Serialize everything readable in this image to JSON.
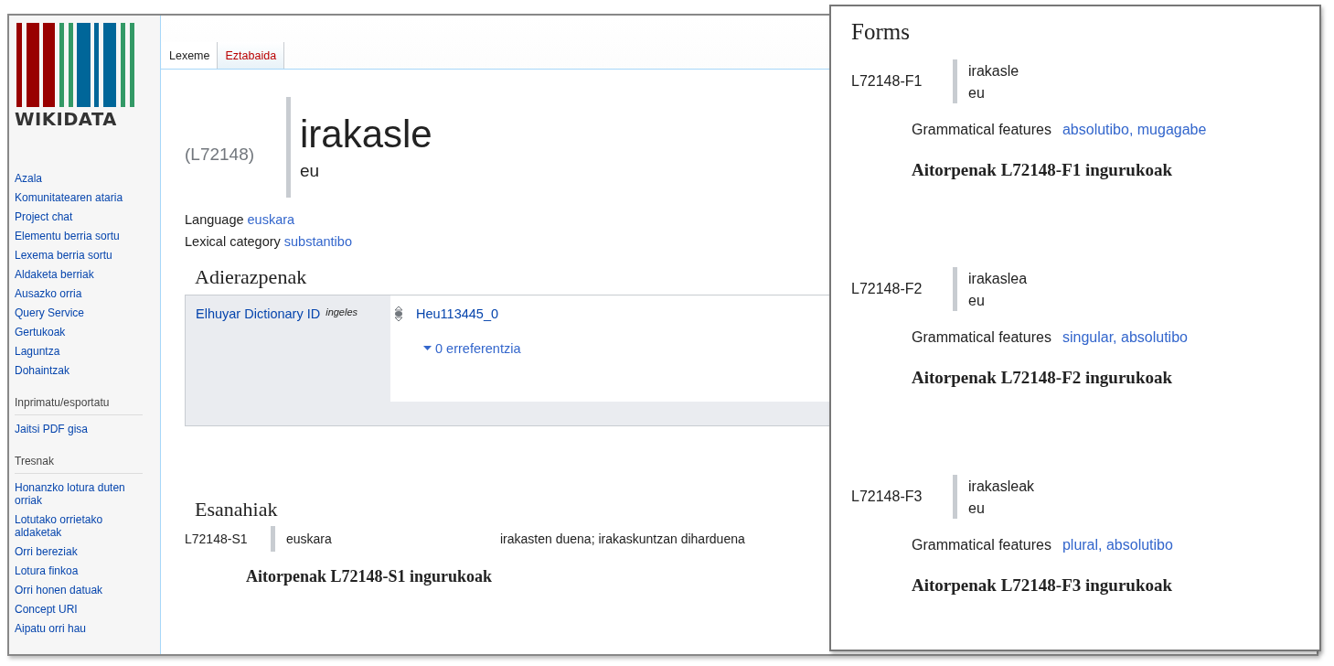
{
  "logo": {
    "wordmark": "WIKIDATA"
  },
  "sidebar": {
    "groups": [
      {
        "items": [
          "Azala",
          "Komunitatearen ataria",
          "Project chat",
          "Elementu berria sortu",
          "Lexema berria sortu",
          "Aldaketa berriak",
          "Ausazko orria",
          "Query Service",
          "Gertukoak",
          "Laguntza",
          "Dohaintzak"
        ]
      },
      {
        "heading": "Inprimatu/esportatu",
        "items": [
          "Jaitsi PDF gisa"
        ]
      },
      {
        "heading": "Tresnak",
        "items": [
          "Honanzko lotura duten orriak",
          "Lotutako orrietako aldaketak",
          "Orri bereziak",
          "Lotura finkoa",
          "Orri honen datuak",
          "Concept URI",
          "Aipatu orri hau"
        ]
      }
    ]
  },
  "tabs": [
    {
      "label": "Lexeme",
      "selected": true
    },
    {
      "label": "Eztabaida",
      "selected": false
    }
  ],
  "lexeme": {
    "id": "(L72148)",
    "lemma": "irakasle",
    "language_code": "eu"
  },
  "properties": [
    {
      "label": "Language",
      "value": "euskara"
    },
    {
      "label": "Lexical category",
      "value": "substantibo"
    }
  ],
  "statements": {
    "heading": "Adierazpenak",
    "items": [
      {
        "property": "Elhuyar Dictionary ID",
        "qualifier": "ingeles",
        "value": "Heu113445_0",
        "references": "0 erreferentzia"
      }
    ]
  },
  "senses": {
    "heading": "Esanahiak",
    "items": [
      {
        "id": "L72148-S1",
        "language": "euskara",
        "gloss": "irakasten duena; irakaskuntzan diharduena",
        "statements_heading": "Aitorpenak L72148-S1 ingurukoak"
      }
    ]
  },
  "forms": {
    "heading": "Forms",
    "items": [
      {
        "id": "L72148-F1",
        "representation": "irakasle",
        "language_code": "eu",
        "features_label": "Grammatical features",
        "features": "absolutibo, mugagabe",
        "statements_heading": "Aitorpenak L72148-F1 ingurukoak"
      },
      {
        "id": "L72148-F2",
        "representation": "irakaslea",
        "language_code": "eu",
        "features_label": "Grammatical features",
        "features": "singular, absolutibo",
        "statements_heading": "Aitorpenak L72148-F2 ingurukoak"
      },
      {
        "id": "L72148-F3",
        "representation": "irakasleak",
        "language_code": "eu",
        "features_label": "Grammatical features",
        "features": "plural, absolutibo",
        "statements_heading": "Aitorpenak L72148-F3 ingurukoak"
      }
    ]
  }
}
